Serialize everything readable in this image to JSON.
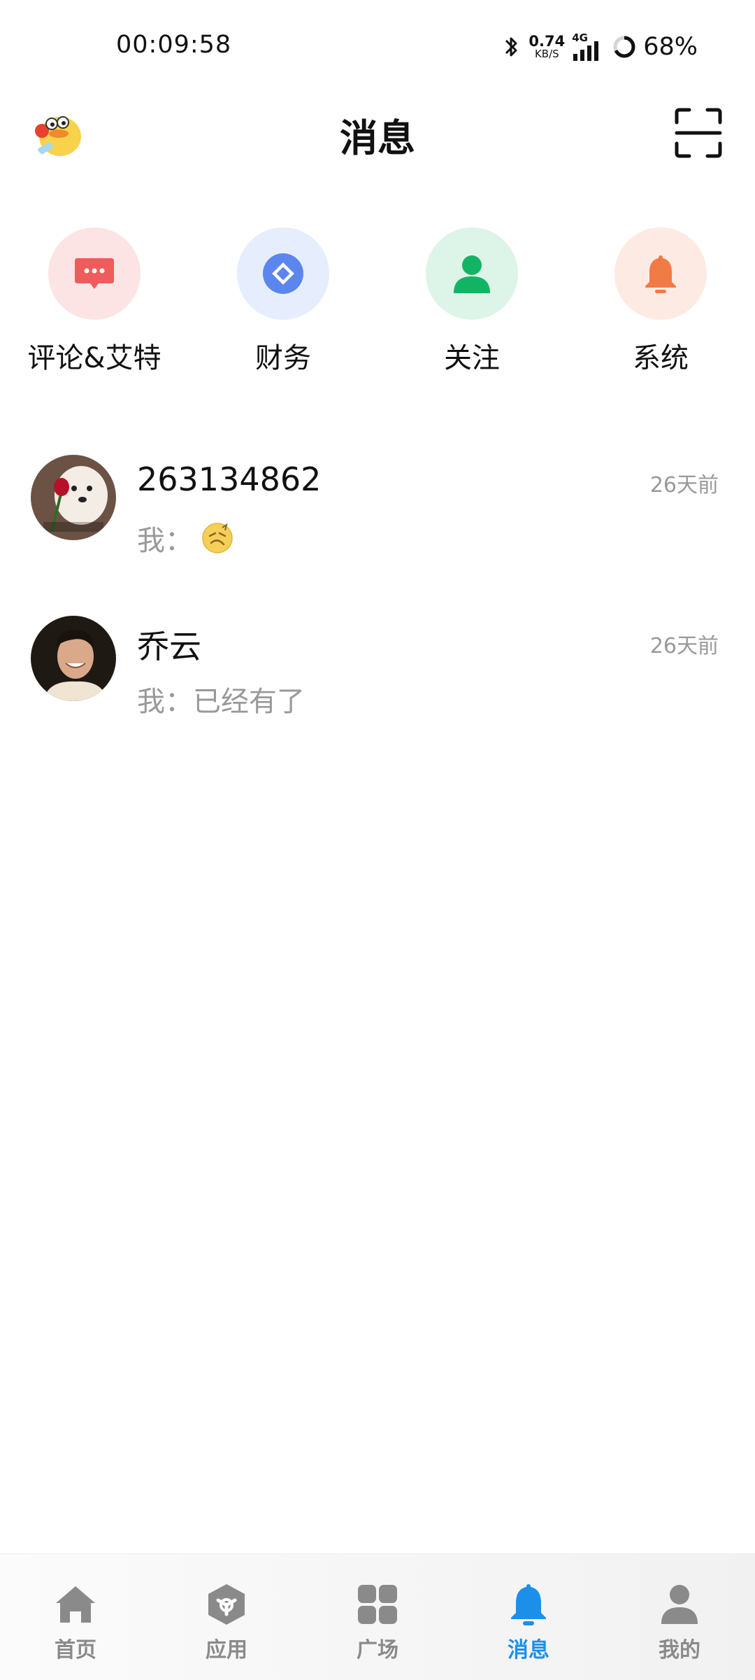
{
  "status_bar": {
    "time": "00:09:58",
    "net_speed_value": "0.74",
    "net_speed_unit": "KB/S",
    "network_type": "4G",
    "battery": "68%"
  },
  "header": {
    "title": "消息"
  },
  "shortcuts": [
    {
      "label": "评论&艾特",
      "icon": "comment-icon",
      "color": "#f05b5b",
      "bg": "#fde4e4"
    },
    {
      "label": "财务",
      "icon": "finance-icon",
      "color": "#5b86ee",
      "bg": "#e6edfd"
    },
    {
      "label": "关注",
      "icon": "follow-icon",
      "color": "#12b464",
      "bg": "#ddf5e8"
    },
    {
      "label": "系统",
      "icon": "bell-icon",
      "color": "#f27a44",
      "bg": "#fdeae2"
    }
  ],
  "conversations": [
    {
      "name": "263134862",
      "preview_prefix": "我：",
      "preview_text": "",
      "preview_emoji": "emoji-icon",
      "time": "26天前"
    },
    {
      "name": "乔云",
      "preview_prefix": "我：",
      "preview_text": "已经有了",
      "time": "26天前"
    }
  ],
  "bottom_nav": [
    {
      "label": "首页",
      "icon": "home-icon",
      "active": false
    },
    {
      "label": "应用",
      "icon": "apps-cube-icon",
      "active": false
    },
    {
      "label": "广场",
      "icon": "grid-icon",
      "active": false
    },
    {
      "label": "消息",
      "icon": "bell-icon",
      "active": true
    },
    {
      "label": "我的",
      "icon": "profile-icon",
      "active": false
    }
  ],
  "colors": {
    "accent": "#1c8fe8",
    "inactive_nav": "#8a8a8a",
    "secondary_text": "#999999"
  }
}
